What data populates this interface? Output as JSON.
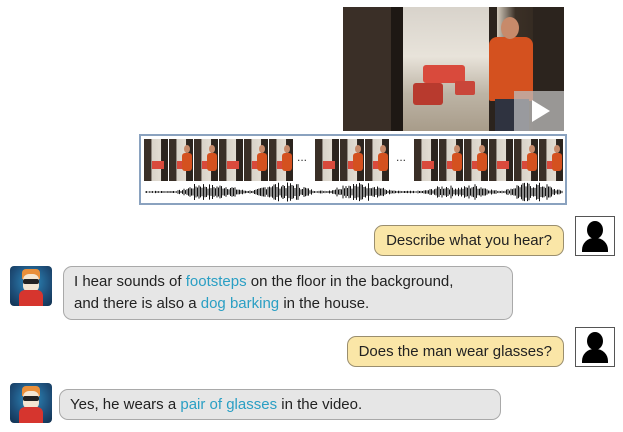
{
  "video": {
    "play_icon": "play-icon"
  },
  "strip": {
    "ellipsis_1": "...",
    "ellipsis_2": "..."
  },
  "chat": [
    {
      "role": "user",
      "text": "Describe what you hear?",
      "avatar_icon": "user-icon"
    },
    {
      "role": "assistant",
      "parts": [
        {
          "text": "I hear sounds of ",
          "highlight": false
        },
        {
          "text": "footsteps",
          "highlight": true
        },
        {
          "text": " on the floor in the background,",
          "highlight": false
        },
        {
          "text": "and there is also a ",
          "highlight": false
        },
        {
          "text": "dog barking",
          "highlight": true
        },
        {
          "text": " in the house.",
          "highlight": false
        }
      ],
      "avatar_icon": "llama-avatar-icon"
    },
    {
      "role": "user",
      "text": "Does the man wear glasses?",
      "avatar_icon": "user-icon"
    },
    {
      "role": "assistant",
      "parts": [
        {
          "text": "Yes, he wears a ",
          "highlight": false
        },
        {
          "text": "pair of glasses",
          "highlight": true
        },
        {
          "text": " in the video.",
          "highlight": false
        }
      ],
      "avatar_icon": "llama-avatar-icon"
    }
  ],
  "colors": {
    "highlight": "#2a9fc4",
    "user_bubble": "#fae6a7",
    "bot_bubble": "#e6e6e6",
    "strip_border": "#8aa2bf"
  }
}
